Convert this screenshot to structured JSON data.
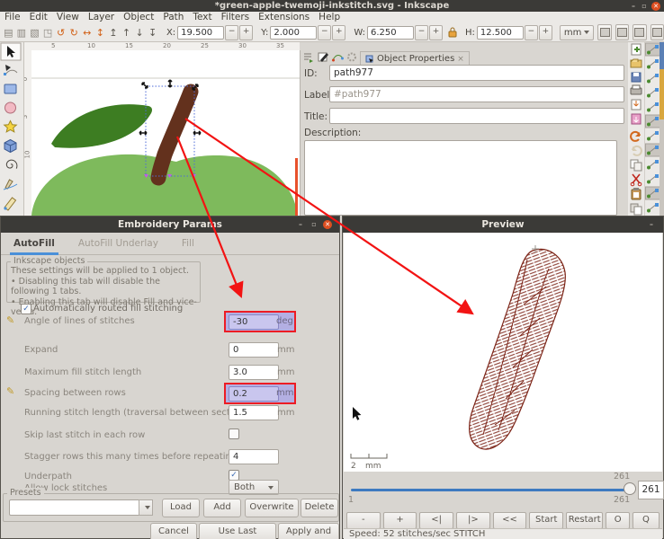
{
  "window": {
    "title": "*green-apple-twemoji-inkstitch.svg - Inkscape"
  },
  "icons": {
    "close": "✕",
    "minimize": "–",
    "maximize": "▫",
    "check": "✓",
    "pencil": "✎",
    "tab_close": "×",
    "text_tool": "A"
  },
  "menu": {
    "items": [
      "File",
      "Edit",
      "View",
      "Layer",
      "Object",
      "Path",
      "Text",
      "Filters",
      "Extensions",
      "Help"
    ]
  },
  "toolbar": {
    "icons": [
      "▤",
      "▥",
      "▧",
      "◳",
      "↺",
      "↻",
      "↔",
      "↕",
      "↥",
      "↑",
      "↓",
      "↧"
    ],
    "x_label": "X:",
    "x_value": "19.500",
    "y_label": "Y:",
    "y_value": "2.000",
    "w_label": "W:",
    "w_value": "6.250",
    "h_label": "H:",
    "h_value": "12.500",
    "unit": "mm",
    "minus": "−",
    "plus": "+"
  },
  "rulers": {
    "top": [
      "5",
      "10",
      "15",
      "20",
      "25",
      "30",
      "35"
    ],
    "left": [
      "0",
      "5",
      "10"
    ]
  },
  "object_properties": {
    "tab": "Object Properties",
    "id_label": "ID:",
    "id_value": "path977",
    "label_label": "Label:",
    "label_value": "#path977",
    "title_label": "Title:",
    "description_label": "Description:"
  },
  "params": {
    "title": "Embroidery Params",
    "tabs": [
      "AutoFill",
      "AutoFill Underlay",
      "Fill"
    ],
    "group_title": "Inkscape objects",
    "line1": "These settings will be applied to 1 object.",
    "line2": "• Disabling this tab will disable the following 1 tabs.",
    "line3": "• Enabling this tab will disable Fill and vice-versa.",
    "auto_label": "Automatically routed fill stitching",
    "rows": [
      {
        "label": "Angle of lines of stitches",
        "value": "-30",
        "unit": "deg"
      },
      {
        "label": "Expand",
        "value": "0",
        "unit": "mm"
      },
      {
        "label": "Maximum fill stitch length",
        "value": "3.0",
        "unit": "mm"
      },
      {
        "label": "Spacing between rows",
        "value": "0.2",
        "unit": "mm"
      },
      {
        "label": "Running stitch length (traversal between sections)",
        "value": "1.5",
        "unit": "mm"
      },
      {
        "label": "Skip last stitch in each row"
      },
      {
        "label": "Stagger rows this many times before repeating",
        "value": "4"
      },
      {
        "label": "Underpath"
      },
      {
        "label": "Allow lock stitches",
        "value": "Both"
      }
    ],
    "presets_label": "Presets",
    "btn_load": "Load",
    "btn_add": "Add",
    "btn_overwrite": "Overwrite",
    "btn_delete": "Delete",
    "btn_cancel": "Cancel",
    "btn_use_last": "Use Last Settings",
    "btn_apply": "Apply and Quit"
  },
  "preview": {
    "title": "Preview",
    "scale_value": "2",
    "scale_unit": "mm",
    "slider_max_top": "261",
    "slider_min": "1",
    "slider_max_bottom": "261",
    "value_box": "261",
    "buttons": [
      "-",
      "+",
      "<|",
      "|>",
      "<<",
      "Start",
      "Restart",
      "O",
      "Q"
    ],
    "speed": "Speed: 52 stitches/sec",
    "mode": "STITCH"
  },
  "colors": {
    "apple_body": "#7EBA5C",
    "apple_leaf": "#3D7D22",
    "stem": "#63311D",
    "stitch": "#7C2417",
    "slider_blue": "#3D7AC0",
    "highlight_bg": "#B3AFE2",
    "highlight_border": "#ED1C24",
    "arrow_red": "#F21313",
    "accent_blue": "#4A90D9"
  }
}
